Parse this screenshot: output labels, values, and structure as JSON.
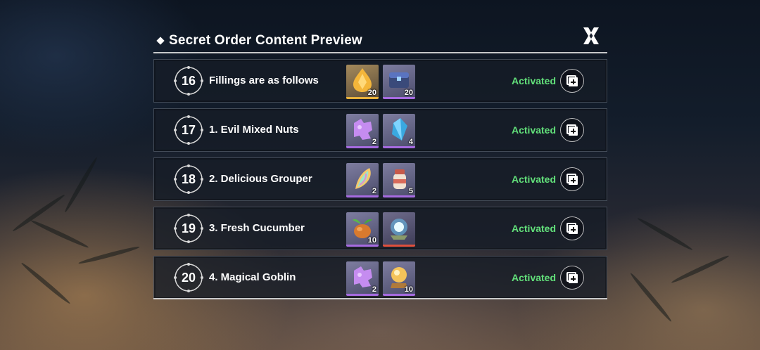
{
  "header": {
    "title": "Secret Order Content Preview"
  },
  "rows": [
    {
      "number": "16",
      "title": "Fillings are as follows",
      "status": "Activated",
      "items": [
        {
          "icon": "amber-crystal-icon",
          "qty": "20",
          "rarity": "gold"
        },
        {
          "icon": "blue-treasure-chest-icon",
          "qty": "20",
          "rarity": "purple"
        }
      ]
    },
    {
      "number": "17",
      "title": "1. Evil Mixed Nuts",
      "status": "Activated",
      "items": [
        {
          "icon": "purple-puzzle-piece-icon",
          "qty": "2",
          "rarity": "purple"
        },
        {
          "icon": "blue-crystal-icon",
          "qty": "4",
          "rarity": "purple"
        }
      ]
    },
    {
      "number": "18",
      "title": "2. Delicious Grouper",
      "status": "Activated",
      "items": [
        {
          "icon": "rainbow-feather-icon",
          "qty": "2",
          "rarity": "purple"
        },
        {
          "icon": "jar-icon",
          "qty": "5",
          "rarity": "purple"
        }
      ]
    },
    {
      "number": "19",
      "title": "3. Fresh Cucumber",
      "status": "Activated",
      "items": [
        {
          "icon": "root-vegetable-icon",
          "qty": "10",
          "rarity": "purple"
        },
        {
          "icon": "glowing-orb-icon",
          "qty": "",
          "rarity": "red"
        }
      ]
    },
    {
      "number": "20",
      "title": "4. Magical Goblin",
      "status": "Activated",
      "items": [
        {
          "icon": "purple-puzzle-piece-icon",
          "qty": "2",
          "rarity": "purple"
        },
        {
          "icon": "crystal-ball-icon",
          "qty": "10",
          "rarity": "purple"
        }
      ]
    }
  ],
  "colors": {
    "activated": "#62e07a",
    "rarity_gold": "#e8b23c",
    "rarity_purple": "#a66be0",
    "rarity_red": "#e0503c"
  }
}
